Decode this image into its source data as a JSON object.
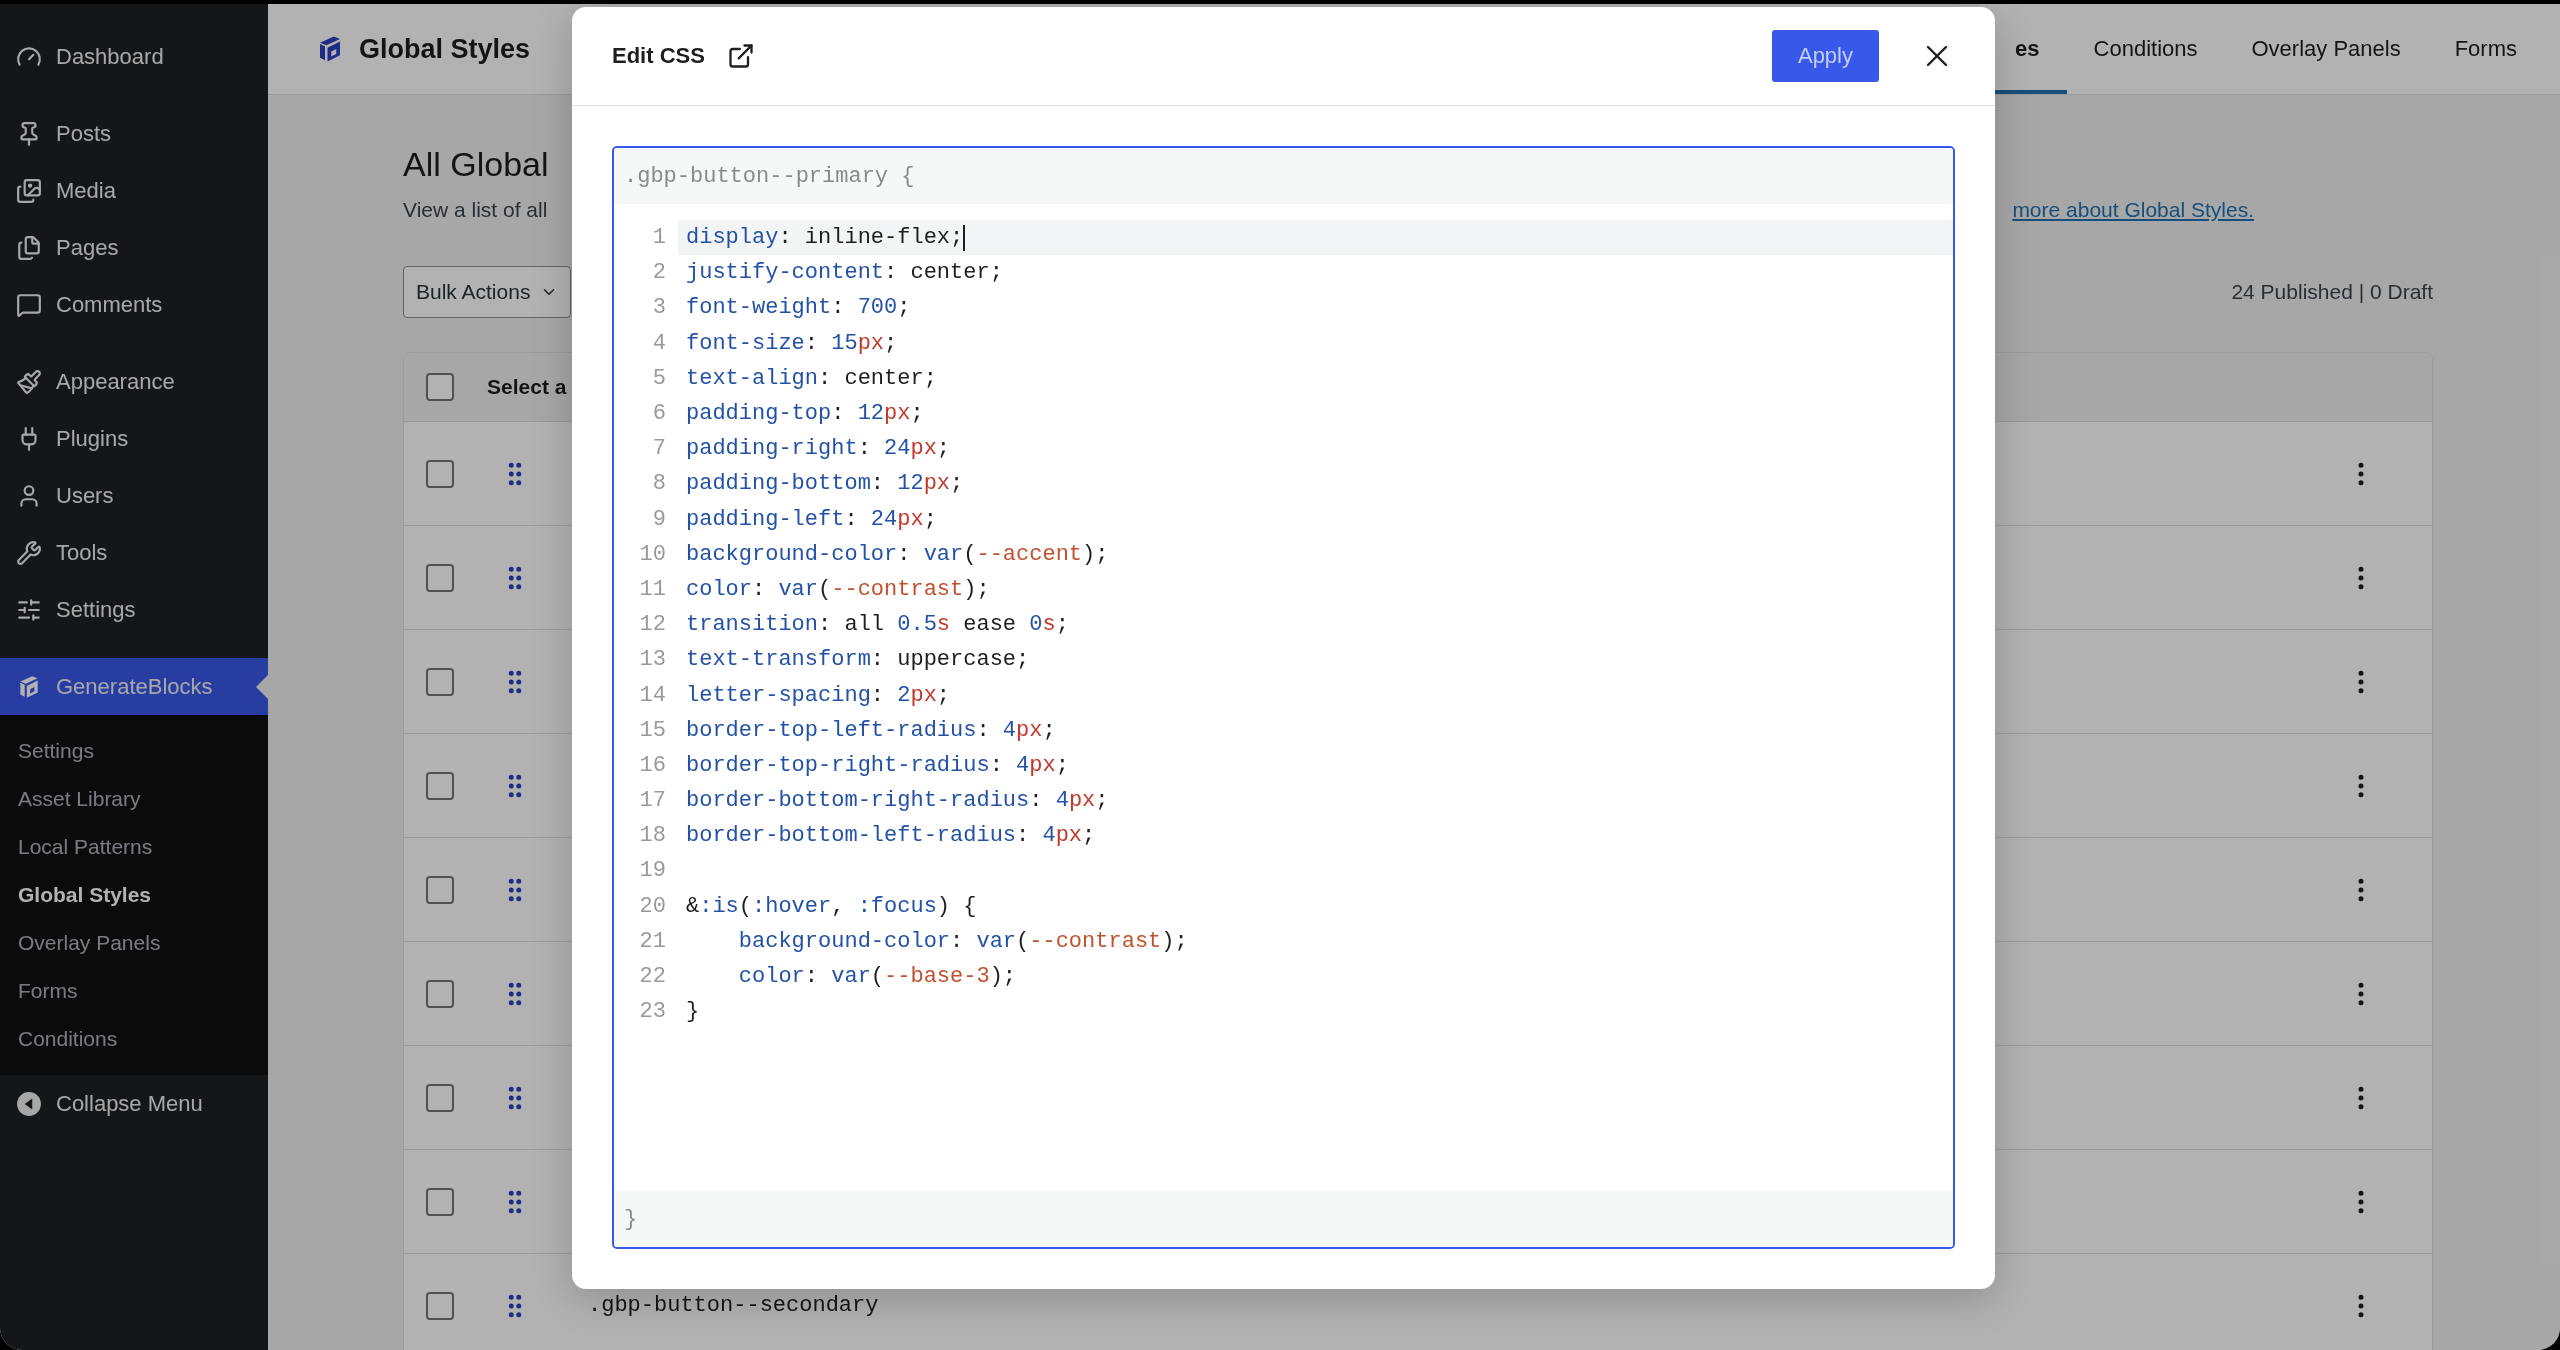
{
  "sidebar": {
    "groups": [
      {
        "items": [
          {
            "label": "Dashboard",
            "selected": false
          }
        ]
      },
      {
        "items": [
          {
            "label": "Posts",
            "selected": false
          },
          {
            "label": "Media",
            "selected": false
          },
          {
            "label": "Pages",
            "selected": false
          },
          {
            "label": "Comments",
            "selected": false
          }
        ]
      },
      {
        "items": [
          {
            "label": "Appearance",
            "selected": false
          },
          {
            "label": "Plugins",
            "selected": false
          },
          {
            "label": "Users",
            "selected": false
          },
          {
            "label": "Tools",
            "selected": false
          },
          {
            "label": "Settings",
            "selected": false
          }
        ]
      },
      {
        "items": [
          {
            "label": "GenerateBlocks",
            "selected": true,
            "submenu": [
              {
                "label": "Settings",
                "selected": false
              },
              {
                "label": "Asset Library",
                "selected": false
              },
              {
                "label": "Local Patterns",
                "selected": false
              },
              {
                "label": "Global Styles",
                "selected": true
              },
              {
                "label": "Overlay Panels",
                "selected": false
              },
              {
                "label": "Forms",
                "selected": false
              },
              {
                "label": "Conditions",
                "selected": false
              }
            ]
          },
          {
            "label": "Collapse Menu",
            "selected": false
          }
        ]
      }
    ]
  },
  "header": {
    "title": "Global Styles",
    "tabs": [
      {
        "label": "es",
        "selected": true
      },
      {
        "label": "Conditions",
        "selected": false
      },
      {
        "label": "Overlay Panels",
        "selected": false
      },
      {
        "label": "Forms",
        "selected": false
      }
    ]
  },
  "page": {
    "title": "All Global",
    "description": "View a list of all",
    "link": "more about Global Styles.",
    "bulk_actions": "Bulk Actions",
    "counts": "24 Published | 0 Draft",
    "table": {
      "header": {
        "label": "Select a",
        "checked": false
      },
      "rows": [
        {
          "checked": false
        },
        {
          "checked": false
        },
        {
          "checked": false
        },
        {
          "checked": false
        },
        {
          "checked": false
        },
        {
          "checked": false
        },
        {
          "checked": false
        },
        {
          "checked": false
        },
        {
          "checked": false,
          "name": ".gbp-button--secondary"
        }
      ]
    }
  },
  "modal": {
    "title": "Edit CSS",
    "apply": "Apply",
    "selector": ".gbp-button--primary {",
    "closing": "}",
    "lines": [
      {
        "number": "1",
        "active": true,
        "cursor": true,
        "tokens": [
          {
            "kind": "property",
            "text": "display"
          },
          {
            "kind": "plain",
            "text": ": inline-flex;"
          }
        ]
      },
      {
        "number": "2",
        "active": false,
        "cursor": false,
        "tokens": [
          {
            "kind": "property",
            "text": "justify-content"
          },
          {
            "kind": "plain",
            "text": ": center;"
          }
        ]
      },
      {
        "number": "3",
        "active": false,
        "cursor": false,
        "tokens": [
          {
            "kind": "property",
            "text": "font-weight"
          },
          {
            "kind": "plain",
            "text": ": "
          },
          {
            "kind": "number",
            "text": "700"
          },
          {
            "kind": "plain",
            "text": ";"
          }
        ]
      },
      {
        "number": "4",
        "active": false,
        "cursor": false,
        "tokens": [
          {
            "kind": "property",
            "text": "font-size"
          },
          {
            "kind": "plain",
            "text": ": "
          },
          {
            "kind": "number",
            "text": "15"
          },
          {
            "kind": "unit",
            "text": "px"
          },
          {
            "kind": "plain",
            "text": ";"
          }
        ]
      },
      {
        "number": "5",
        "active": false,
        "cursor": false,
        "tokens": [
          {
            "kind": "property",
            "text": "text-align"
          },
          {
            "kind": "plain",
            "text": ": center;"
          }
        ]
      },
      {
        "number": "6",
        "active": false,
        "cursor": false,
        "tokens": [
          {
            "kind": "property",
            "text": "padding-top"
          },
          {
            "kind": "plain",
            "text": ": "
          },
          {
            "kind": "number",
            "text": "12"
          },
          {
            "kind": "unit",
            "text": "px"
          },
          {
            "kind": "plain",
            "text": ";"
          }
        ]
      },
      {
        "number": "7",
        "active": false,
        "cursor": false,
        "tokens": [
          {
            "kind": "property",
            "text": "padding-right"
          },
          {
            "kind": "plain",
            "text": ": "
          },
          {
            "kind": "number",
            "text": "24"
          },
          {
            "kind": "unit",
            "text": "px"
          },
          {
            "kind": "plain",
            "text": ";"
          }
        ]
      },
      {
        "number": "8",
        "active": false,
        "cursor": false,
        "tokens": [
          {
            "kind": "property",
            "text": "padding-bottom"
          },
          {
            "kind": "plain",
            "text": ": "
          },
          {
            "kind": "number",
            "text": "12"
          },
          {
            "kind": "unit",
            "text": "px"
          },
          {
            "kind": "plain",
            "text": ";"
          }
        ]
      },
      {
        "number": "9",
        "active": false,
        "cursor": false,
        "tokens": [
          {
            "kind": "property",
            "text": "padding-left"
          },
          {
            "kind": "plain",
            "text": ": "
          },
          {
            "kind": "number",
            "text": "24"
          },
          {
            "kind": "unit",
            "text": "px"
          },
          {
            "kind": "plain",
            "text": ";"
          }
        ]
      },
      {
        "number": "10",
        "active": false,
        "cursor": false,
        "tokens": [
          {
            "kind": "property",
            "text": "background-color"
          },
          {
            "kind": "plain",
            "text": ": "
          },
          {
            "kind": "number",
            "text": "var"
          },
          {
            "kind": "plain",
            "text": "("
          },
          {
            "kind": "variable",
            "text": "--accent"
          },
          {
            "kind": "plain",
            "text": ");"
          }
        ]
      },
      {
        "number": "11",
        "active": false,
        "cursor": false,
        "tokens": [
          {
            "kind": "property",
            "text": "color"
          },
          {
            "kind": "plain",
            "text": ": "
          },
          {
            "kind": "number",
            "text": "var"
          },
          {
            "kind": "plain",
            "text": "("
          },
          {
            "kind": "variable",
            "text": "--contrast"
          },
          {
            "kind": "plain",
            "text": ");"
          }
        ]
      },
      {
        "number": "12",
        "active": false,
        "cursor": false,
        "tokens": [
          {
            "kind": "property",
            "text": "transition"
          },
          {
            "kind": "plain",
            "text": ": all "
          },
          {
            "kind": "number",
            "text": "0.5"
          },
          {
            "kind": "unit",
            "text": "s"
          },
          {
            "kind": "plain",
            "text": " ease "
          },
          {
            "kind": "number",
            "text": "0"
          },
          {
            "kind": "unit",
            "text": "s"
          },
          {
            "kind": "plain",
            "text": ";"
          }
        ]
      },
      {
        "number": "13",
        "active": false,
        "cursor": false,
        "tokens": [
          {
            "kind": "property",
            "text": "text-transform"
          },
          {
            "kind": "plain",
            "text": ": uppercase;"
          }
        ]
      },
      {
        "number": "14",
        "active": false,
        "cursor": false,
        "tokens": [
          {
            "kind": "property",
            "text": "letter-spacing"
          },
          {
            "kind": "plain",
            "text": ": "
          },
          {
            "kind": "number",
            "text": "2"
          },
          {
            "kind": "unit",
            "text": "px"
          },
          {
            "kind": "plain",
            "text": ";"
          }
        ]
      },
      {
        "number": "15",
        "active": false,
        "cursor": false,
        "tokens": [
          {
            "kind": "property",
            "text": "border-top-left-radius"
          },
          {
            "kind": "plain",
            "text": ": "
          },
          {
            "kind": "number",
            "text": "4"
          },
          {
            "kind": "unit",
            "text": "px"
          },
          {
            "kind": "plain",
            "text": ";"
          }
        ]
      },
      {
        "number": "16",
        "active": false,
        "cursor": false,
        "tokens": [
          {
            "kind": "property",
            "text": "border-top-right-radius"
          },
          {
            "kind": "plain",
            "text": ": "
          },
          {
            "kind": "number",
            "text": "4"
          },
          {
            "kind": "unit",
            "text": "px"
          },
          {
            "kind": "plain",
            "text": ";"
          }
        ]
      },
      {
        "number": "17",
        "active": false,
        "cursor": false,
        "tokens": [
          {
            "kind": "property",
            "text": "border-bottom-right-radius"
          },
          {
            "kind": "plain",
            "text": ": "
          },
          {
            "kind": "number",
            "text": "4"
          },
          {
            "kind": "unit",
            "text": "px"
          },
          {
            "kind": "plain",
            "text": ";"
          }
        ]
      },
      {
        "number": "18",
        "active": false,
        "cursor": false,
        "tokens": [
          {
            "kind": "property",
            "text": "border-bottom-left-radius"
          },
          {
            "kind": "plain",
            "text": ": "
          },
          {
            "kind": "number",
            "text": "4"
          },
          {
            "kind": "unit",
            "text": "px"
          },
          {
            "kind": "plain",
            "text": ";"
          }
        ]
      },
      {
        "number": "19",
        "active": false,
        "cursor": false
      },
      {
        "number": "20",
        "active": false,
        "cursor": false,
        "tokens": [
          {
            "kind": "plain",
            "text": "&"
          },
          {
            "kind": "property",
            "text": ":is"
          },
          {
            "kind": "plain",
            "text": "("
          },
          {
            "kind": "property",
            "text": ":hover"
          },
          {
            "kind": "plain",
            "text": ", "
          },
          {
            "kind": "property",
            "text": ":focus"
          },
          {
            "kind": "plain",
            "text": ") {"
          }
        ]
      },
      {
        "number": "21",
        "active": false,
        "cursor": false,
        "tokens": [
          {
            "kind": "property",
            "text": "    background-color"
          },
          {
            "kind": "plain",
            "text": ": "
          },
          {
            "kind": "number",
            "text": "var"
          },
          {
            "kind": "plain",
            "text": "("
          },
          {
            "kind": "variable",
            "text": "--contrast"
          },
          {
            "kind": "plain",
            "text": ");"
          }
        ]
      },
      {
        "number": "22",
        "active": false,
        "cursor": false,
        "tokens": [
          {
            "kind": "property",
            "text": "    color"
          },
          {
            "kind": "plain",
            "text": ": "
          },
          {
            "kind": "number",
            "text": "var"
          },
          {
            "kind": "plain",
            "text": "("
          },
          {
            "kind": "variable",
            "text": "--base-3"
          },
          {
            "kind": "plain",
            "text": ");"
          }
        ]
      },
      {
        "number": "23",
        "active": false,
        "cursor": false,
        "tokens": [
          {
            "kind": "plain",
            "text": "}"
          }
        ]
      }
    ]
  }
}
